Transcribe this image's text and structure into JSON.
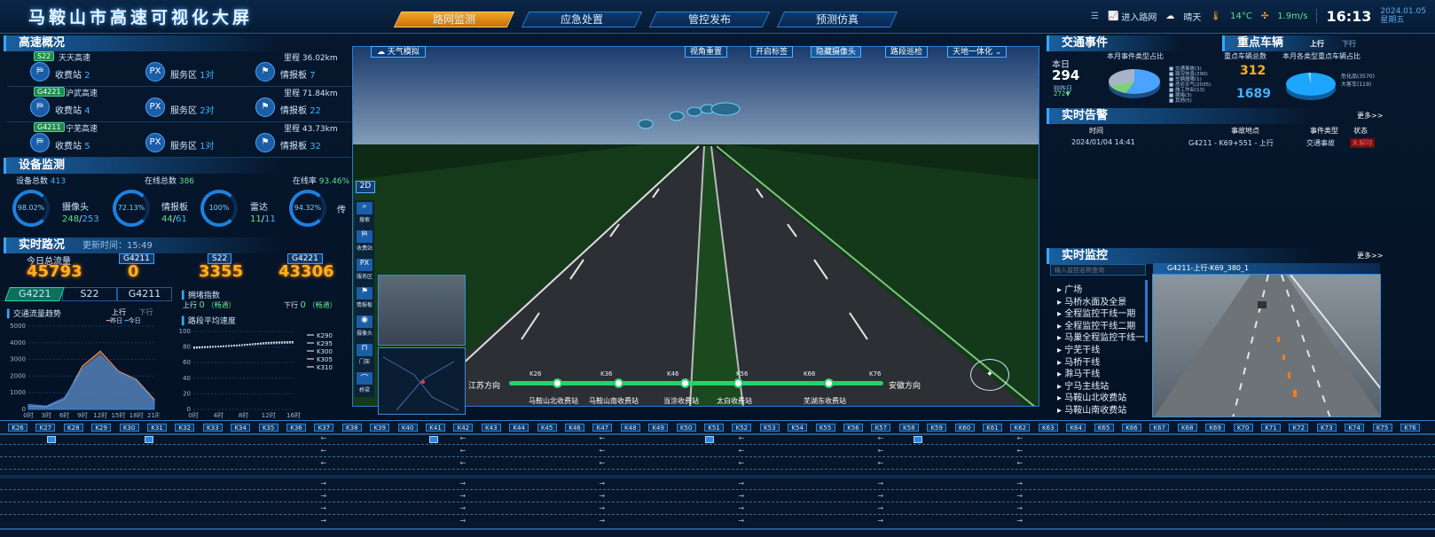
{
  "app_title": "马鞍山市高速可视化大屏",
  "nav_tabs": [
    {
      "label": "路网监测",
      "active": true
    },
    {
      "label": "应急处置",
      "active": false
    },
    {
      "label": "管控发布",
      "active": false
    },
    {
      "label": "预测仿真",
      "active": false
    }
  ],
  "header_right": {
    "enter_label": "进入路网",
    "weather": "晴天",
    "temp": "14°C",
    "wind": "1.9m/s",
    "time": "16:13",
    "date": "2024.01.05",
    "weekday": "星期五"
  },
  "highway_overview": {
    "title": "高速概况",
    "rows": [
      {
        "code": "S22",
        "name": "天天高速",
        "mileage_label": "里程",
        "mileage": "36.02km",
        "toll_label": "收费站",
        "toll": "2",
        "service_label": "服务区",
        "service": "1对",
        "board_label": "情报板",
        "board": "7"
      },
      {
        "code": "G4221",
        "name": "沪武高速",
        "mileage_label": "里程",
        "mileage": "71.84km",
        "toll_label": "收费站",
        "toll": "4",
        "service_label": "服务区",
        "service": "2对",
        "board_label": "情报板",
        "board": "22"
      },
      {
        "code": "G4211",
        "name": "宁芜高速",
        "mileage_label": "里程",
        "mileage": "43.73km",
        "toll_label": "收费站",
        "toll": "5",
        "service_label": "服务区",
        "service": "1对",
        "board_label": "情报板",
        "board": "32"
      }
    ]
  },
  "device": {
    "title": "设备监测",
    "total_label": "设备总数",
    "total": "413",
    "online_label": "在线总数",
    "online": "386",
    "rate_label": "在线率",
    "rate": "93.46%",
    "items": [
      {
        "name": "摄像头",
        "pct": "98.02%",
        "val": "248",
        "total": "253"
      },
      {
        "name": "情报板",
        "pct": "72.13%",
        "val": "44",
        "total": "61"
      },
      {
        "name": "雷达",
        "pct": "100%",
        "val": "11",
        "total": "11"
      },
      {
        "name": "传",
        "pct": "94.32%",
        "val": "",
        "total": ""
      }
    ]
  },
  "realtime": {
    "title": "实时路况",
    "update_label": "更新时间：",
    "update": "15:49",
    "today_label": "今日总流量",
    "today": "45793",
    "roads": [
      {
        "code": "G4211",
        "val": "0"
      },
      {
        "code": "S22",
        "val": "3355"
      },
      {
        "code": "G4221",
        "val": "43306"
      }
    ],
    "road_tabs": [
      "G4221",
      "S22",
      "G4211"
    ],
    "trend_title": "交通流量趋势",
    "up": "上行",
    "down": "下行",
    "yesterday": "昨日",
    "today2": "今日",
    "congest_title": "拥堵指数",
    "up_label": "上行",
    "up_val": "0",
    "up_state": "（畅通）",
    "down_label": "下行",
    "down_val": "0",
    "down_state": "（畅通）",
    "speed_title": "路段平均速度"
  },
  "chart_data": [
    {
      "type": "area",
      "title": "交通流量趋势",
      "x": [
        "0时",
        "3时",
        "6时",
        "9时",
        "12时",
        "15时",
        "18时",
        "21时"
      ],
      "yticks": [
        0,
        1000,
        2000,
        3000,
        4000,
        5000
      ],
      "ylim": [
        0,
        5000
      ],
      "series": [
        {
          "name": "昨日",
          "values": [
            200,
            150,
            600,
            2600,
            3500,
            2300,
            1800,
            600
          ]
        },
        {
          "name": "今日",
          "values": [
            300,
            200,
            700,
            2400,
            3200,
            2200,
            1700,
            500
          ]
        }
      ]
    },
    {
      "type": "line",
      "title": "路段平均速度",
      "x": [
        "0时",
        "4时",
        "8时",
        "12时",
        "16时"
      ],
      "yticks": [
        0,
        20,
        40,
        60,
        80,
        100
      ],
      "ylim": [
        0,
        100
      ],
      "legend": [
        "K290",
        "K295",
        "K300",
        "K305",
        "K310"
      ],
      "series": [
        {
          "name": "K290",
          "values": [
            80,
            81,
            83,
            86,
            87
          ]
        },
        {
          "name": "K295",
          "values": [
            79,
            80,
            82,
            85,
            86
          ]
        },
        {
          "name": "K300",
          "values": [
            78,
            80,
            82,
            84,
            85
          ]
        }
      ]
    }
  ],
  "video": {
    "weather_btn": "天气模拟",
    "buttons": [
      "视角重置",
      "开启标签",
      "隐藏摄像头",
      "路段巡检",
      "天地一体化"
    ],
    "view2d": "2D",
    "side_tools": [
      {
        "label": "搜索"
      },
      {
        "label": "收费站"
      },
      {
        "label": "服务区"
      },
      {
        "label": "情报板"
      },
      {
        "label": "摄像头"
      },
      {
        "label": "门架"
      },
      {
        "label": "桥梁"
      }
    ],
    "dir_left": "江苏方向",
    "dir_right": "安徽方向",
    "kms": [
      "K26",
      "K36",
      "K46",
      "K56",
      "K66",
      "K76"
    ],
    "stations": [
      "马鞍山北收费站",
      "马鞍山南收费站",
      "当涂收费站",
      "太白收费站",
      "芜湖东收费站"
    ]
  },
  "events": {
    "title": "交通事件",
    "today_label": "本日",
    "today": "294",
    "cmp_label": "较昨日",
    "cmp": "272",
    "pie_title": "本月事件类型占比",
    "legend": [
      "交通事故(3)",
      "路况信息(290)",
      "车辆故障(1)",
      "恶劣天气(2035)",
      "施工作业(13)",
      "拥堵(3)",
      "其他(5)"
    ],
    "key_title": "重点车辆",
    "up": "上行",
    "down": "下行",
    "key_total_label": "重点车辆总数",
    "key_total": "312",
    "key_total2": "1689",
    "key_pie_title": "本月各类型重点车辆占比",
    "key_legend": [
      "危化品(3570)",
      "大客车(119)"
    ]
  },
  "alarm": {
    "title": "实时告警",
    "more": "更多>>",
    "cols": [
      "时间",
      "事故地点",
      "事件类型",
      "状态"
    ],
    "rows": [
      {
        "time": "2024/01/04 14:41",
        "place": "G4211 - K69+551 - 上行",
        "type": "交通事故",
        "status": "未解除"
      }
    ]
  },
  "monitor": {
    "title": "实时监控",
    "more": "更多>>",
    "search_placeholder": "输入监控名称查询",
    "items": [
      "广场",
      "马桥水面及全景",
      "全程监控干线一期",
      "全程监控干线二期",
      "马巢全程监控干线一",
      "宁芜干线",
      "马桥干线",
      "滁马干线",
      "宁马主线站",
      "马鞍山北收费站",
      "马鞍山南收费站"
    ],
    "cam_title": "G4211-上行-K69_380_1"
  },
  "lanes": {
    "kms": [
      "K26",
      "K27",
      "K28",
      "K29",
      "K30",
      "K31",
      "K32",
      "K33",
      "K34",
      "K35",
      "K36",
      "K37",
      "K38",
      "K39",
      "K40",
      "K41",
      "K42",
      "K43",
      "K44",
      "K45",
      "K46",
      "K47",
      "K48",
      "K49",
      "K50",
      "K51",
      "K52",
      "K53",
      "K54",
      "K55",
      "K56",
      "K57",
      "K58",
      "K59",
      "K60",
      "K61",
      "K62",
      "K63",
      "K64",
      "K65",
      "K66",
      "K67",
      "K68",
      "K69",
      "K70",
      "K71",
      "K72",
      "K73",
      "K74",
      "K75",
      "K76"
    ]
  }
}
